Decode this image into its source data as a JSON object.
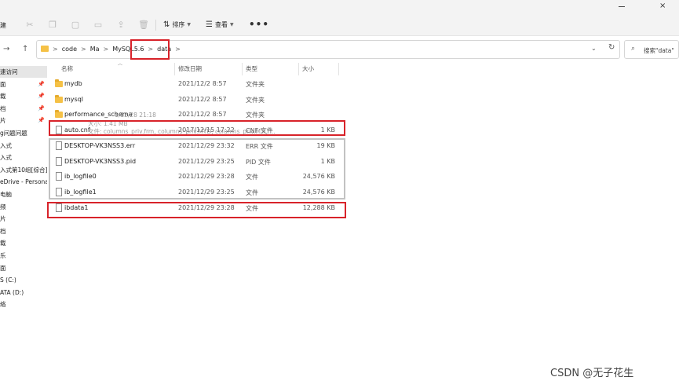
{
  "window": {
    "minimize_label": "",
    "close_glyph": "×"
  },
  "toolbar": {
    "new_label": "建",
    "sort_label": "排序",
    "view_label": "查看",
    "more_glyph": "•••",
    "sort_glyph": "⇅",
    "view_glyph": "☰"
  },
  "address": {
    "crumbs": [
      "code",
      "Ma",
      "MySQL5.6",
      "data"
    ],
    "separator": ">"
  },
  "search": {
    "placeholder": "搜索\"data\""
  },
  "sidebar": {
    "items": [
      {
        "label": "速访问",
        "pinned": false,
        "active": true
      },
      {
        "label": "面",
        "pinned": true
      },
      {
        "label": "载",
        "pinned": true
      },
      {
        "label": "档",
        "pinned": true
      },
      {
        "label": "片",
        "pinned": true
      },
      {
        "label": "g问题问题",
        "pinned": false
      },
      {
        "label": "入式",
        "pinned": false
      },
      {
        "label": "入式",
        "pinned": false
      },
      {
        "label": "入式第10组[综合]",
        "pinned": false
      },
      {
        "label": "eDrive - Persona",
        "pinned": false
      },
      {
        "label": "电脑",
        "pinned": false
      },
      {
        "label": "频",
        "pinned": false
      },
      {
        "label": "片",
        "pinned": false
      },
      {
        "label": "档",
        "pinned": false
      },
      {
        "label": "载",
        "pinned": false
      },
      {
        "label": "乐",
        "pinned": false
      },
      {
        "label": "面",
        "pinned": false
      },
      {
        "label": "S (C:)",
        "pinned": false
      },
      {
        "label": "ATA (D:)",
        "pinned": false
      },
      {
        "label": "络",
        "pinned": false
      }
    ]
  },
  "columns": {
    "name": "名称",
    "date": "修改日期",
    "type": "类型",
    "size": "大小"
  },
  "files": [
    {
      "name": "mydb",
      "date": "2021/12/2 8:57",
      "type": "文件夹",
      "size": "",
      "kind": "folder"
    },
    {
      "name": "mysql",
      "date": "2021/12/2 8:57",
      "type": "文件夹",
      "size": "",
      "kind": "folder"
    },
    {
      "name": "performance_schema",
      "date": "2021/12/2 8:57",
      "type": "文件夹",
      "size": "",
      "kind": "folder"
    },
    {
      "name": "auto.cnf",
      "date": "2017/12/15 17:22",
      "type": "CNF 文件",
      "size": "1 KB",
      "kind": "file"
    },
    {
      "name": "DESKTOP-VK3NSS3.err",
      "date": "2021/12/29 23:32",
      "type": "ERR 文件",
      "size": "19 KB",
      "kind": "file"
    },
    {
      "name": "DESKTOP-VK3NSS3.pid",
      "date": "2021/12/29 23:25",
      "type": "PID 文件",
      "size": "1 KB",
      "kind": "file"
    },
    {
      "name": "ib_logfile0",
      "date": "2021/12/29 23:28",
      "type": "文件",
      "size": "24,576 KB",
      "kind": "file"
    },
    {
      "name": "ib_logfile1",
      "date": "2021/12/29 23:25",
      "type": "文件",
      "size": "24,576 KB",
      "kind": "file"
    },
    {
      "name": "ibdata1",
      "date": "2021/12/29 23:28",
      "type": "文件",
      "size": "12,288 KB",
      "kind": "file"
    }
  ],
  "tooltip": {
    "created": "1/12/28 21:18",
    "size": "大小: 1.41 MB",
    "files": "文件: columns_priv.frm, columns_priv.MYD, columns_priv.MYI, ..."
  },
  "watermark": "CSDN @无子花生",
  "colors": {
    "highlight_red": "#d8232a",
    "highlight_gray": "#c2c2c2",
    "folder": "#f5c146"
  }
}
